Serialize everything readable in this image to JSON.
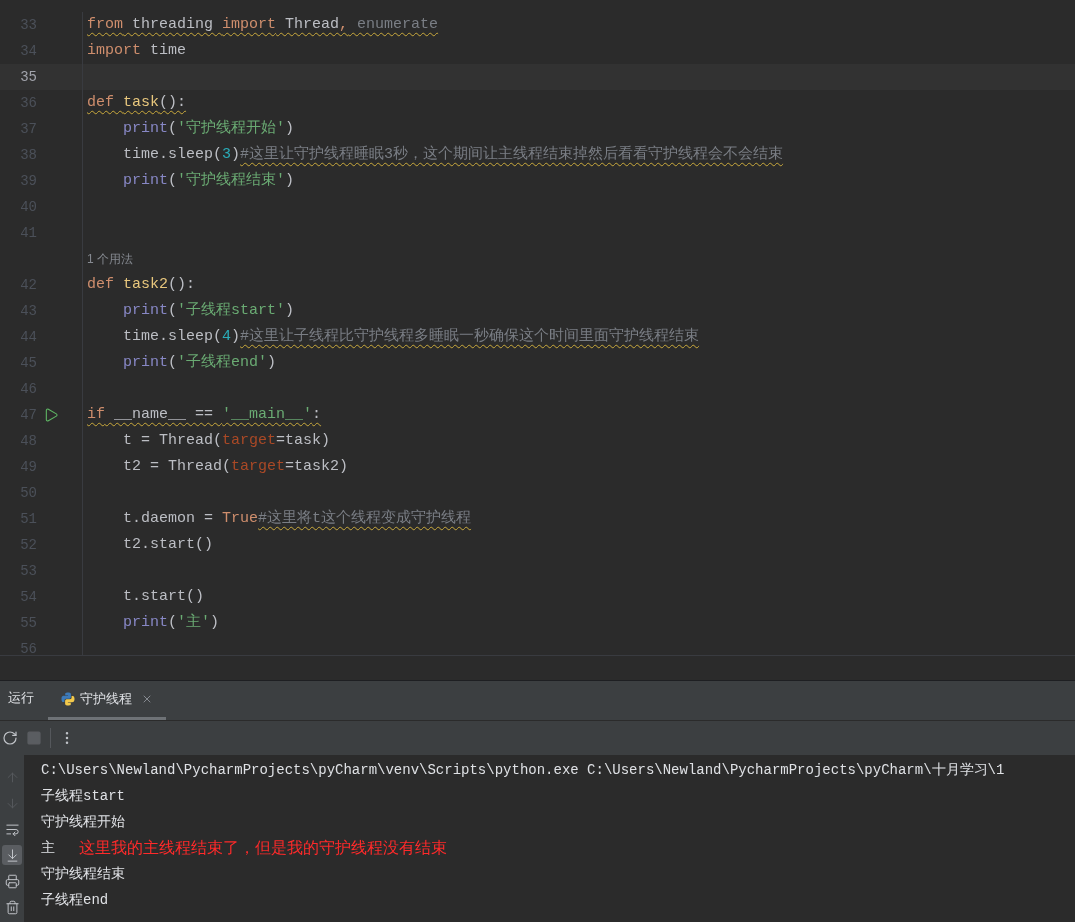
{
  "editor": {
    "lines": [
      {
        "number": "33",
        "current": false,
        "runnable": false,
        "tokens": [
          {
            "text": "from",
            "kind": "keyword",
            "warn": true
          },
          {
            "text": " threading ",
            "kind": "plain",
            "warn": true
          },
          {
            "text": "import",
            "kind": "keyword",
            "warn": true
          },
          {
            "text": " Thread",
            "kind": "plain",
            "warn": true
          },
          {
            "text": ",",
            "kind": "keyword",
            "warn": true
          },
          {
            "text": " enumerate",
            "kind": "unused",
            "warn": true
          }
        ]
      },
      {
        "number": "34",
        "current": false,
        "runnable": false,
        "tokens": [
          {
            "text": "import",
            "kind": "keyword",
            "warn": false
          },
          {
            "text": " time",
            "kind": "plain",
            "warn": false
          }
        ]
      },
      {
        "number": "35",
        "current": true,
        "runnable": false
      },
      {
        "number": "36",
        "current": false,
        "runnable": false,
        "tokens": [
          {
            "text": "def ",
            "kind": "keyword",
            "warn": true
          },
          {
            "text": "task",
            "kind": "function",
            "warn": true
          },
          {
            "text": "():",
            "kind": "plain",
            "warn": true
          }
        ]
      },
      {
        "number": "37",
        "current": false,
        "runnable": false,
        "tokens": [
          {
            "text": "    print",
            "kind": "builtin",
            "warn": false
          },
          {
            "text": "(",
            "kind": "plain",
            "warn": false
          },
          {
            "text": "'守护线程开始'",
            "kind": "string",
            "warn": false
          },
          {
            "text": ")",
            "kind": "plain",
            "warn": false
          }
        ]
      },
      {
        "number": "38",
        "current": false,
        "runnable": false,
        "tokens": [
          {
            "text": "    time.sleep(",
            "kind": "plain",
            "warn": false
          },
          {
            "text": "3",
            "kind": "number",
            "warn": false
          },
          {
            "text": ")",
            "kind": "plain",
            "warn": false
          },
          {
            "text": "#这里让守护线程睡眠3秒，这个期间让主线程结束掉然后看看守护线程会不会结束",
            "kind": "comment",
            "warn": true
          }
        ]
      },
      {
        "number": "39",
        "current": false,
        "runnable": false,
        "tokens": [
          {
            "text": "    print",
            "kind": "builtin",
            "warn": false
          },
          {
            "text": "(",
            "kind": "plain",
            "warn": false
          },
          {
            "text": "'守护线程结束'",
            "kind": "string",
            "warn": false
          },
          {
            "text": ")",
            "kind": "plain",
            "warn": false
          }
        ]
      },
      {
        "number": "40",
        "current": false,
        "runnable": false
      },
      {
        "number": "41",
        "current": false,
        "runnable": false
      },
      {
        "number": "42",
        "current": false,
        "runnable": false,
        "usage_hint": "1 个用法",
        "tokens": [
          {
            "text": "def ",
            "kind": "keyword",
            "warn": false
          },
          {
            "text": "task2",
            "kind": "function",
            "warn": false
          },
          {
            "text": "():",
            "kind": "plain",
            "warn": false
          }
        ]
      },
      {
        "number": "43",
        "current": false,
        "runnable": false,
        "tokens": [
          {
            "text": "    print",
            "kind": "builtin",
            "warn": false
          },
          {
            "text": "(",
            "kind": "plain",
            "warn": false
          },
          {
            "text": "'子线程start'",
            "kind": "string",
            "warn": false
          },
          {
            "text": ")",
            "kind": "plain",
            "warn": false
          }
        ]
      },
      {
        "number": "44",
        "current": false,
        "runnable": false,
        "tokens": [
          {
            "text": "    time.sleep(",
            "kind": "plain",
            "warn": false
          },
          {
            "text": "4",
            "kind": "number",
            "warn": false
          },
          {
            "text": ")",
            "kind": "plain",
            "warn": false
          },
          {
            "text": "#这里让子线程比守护线程多睡眠一秒确保这个时间里面守护线程结束",
            "kind": "comment",
            "warn": true
          }
        ]
      },
      {
        "number": "45",
        "current": false,
        "runnable": false,
        "tokens": [
          {
            "text": "    print",
            "kind": "builtin",
            "warn": false
          },
          {
            "text": "(",
            "kind": "plain",
            "warn": false
          },
          {
            "text": "'子线程end'",
            "kind": "string",
            "warn": false
          },
          {
            "text": ")",
            "kind": "plain",
            "warn": false
          }
        ]
      },
      {
        "number": "46",
        "current": false,
        "runnable": false
      },
      {
        "number": "47",
        "current": false,
        "runnable": true,
        "tokens": [
          {
            "text": "if",
            "kind": "keyword",
            "warn": true
          },
          {
            "text": " __name__ == ",
            "kind": "plain",
            "warn": true
          },
          {
            "text": "'__main__'",
            "kind": "string",
            "warn": true
          },
          {
            "text": ":",
            "kind": "plain",
            "warn": true
          }
        ]
      },
      {
        "number": "48",
        "current": false,
        "runnable": false,
        "tokens": [
          {
            "text": "    t = Thread(",
            "kind": "plain",
            "warn": false
          },
          {
            "text": "target",
            "kind": "param",
            "warn": false
          },
          {
            "text": "=task)",
            "kind": "plain",
            "warn": false
          }
        ]
      },
      {
        "number": "49",
        "current": false,
        "runnable": false,
        "tokens": [
          {
            "text": "    t2 = Thread(",
            "kind": "plain",
            "warn": false
          },
          {
            "text": "target",
            "kind": "param",
            "warn": false
          },
          {
            "text": "=task2)",
            "kind": "plain",
            "warn": false
          }
        ]
      },
      {
        "number": "50",
        "current": false,
        "runnable": false
      },
      {
        "number": "51",
        "current": false,
        "runnable": false,
        "tokens": [
          {
            "text": "    t.daemon = ",
            "kind": "plain",
            "warn": false
          },
          {
            "text": "True",
            "kind": "keyword",
            "warn": false
          },
          {
            "text": "#这里将t这个线程变成守护线程",
            "kind": "comment",
            "warn": true
          }
        ]
      },
      {
        "number": "52",
        "current": false,
        "runnable": false,
        "tokens": [
          {
            "text": "    t2.start()",
            "kind": "plain",
            "warn": false
          }
        ]
      },
      {
        "number": "53",
        "current": false,
        "runnable": false
      },
      {
        "number": "54",
        "current": false,
        "runnable": false,
        "tokens": [
          {
            "text": "    t.start()",
            "kind": "plain",
            "warn": false
          }
        ]
      },
      {
        "number": "55",
        "current": false,
        "runnable": false,
        "tokens": [
          {
            "text": "    print",
            "kind": "builtin",
            "warn": false
          },
          {
            "text": "(",
            "kind": "plain",
            "warn": false
          },
          {
            "text": "'主'",
            "kind": "string",
            "warn": false
          },
          {
            "text": ")",
            "kind": "plain",
            "warn": false
          }
        ]
      },
      {
        "number": "56",
        "current": false,
        "runnable": false
      }
    ]
  },
  "run_panel": {
    "title": "运行",
    "tabs": [
      {
        "label": "守护线程",
        "selected": true
      }
    ],
    "toolbar": [
      {
        "kind": "rerun",
        "disabled": false
      },
      {
        "kind": "stop",
        "disabled": true
      },
      {
        "kind": "more",
        "disabled": false
      }
    ],
    "side_tools": [
      {
        "kind": "up",
        "disabled": true,
        "selected": false
      },
      {
        "kind": "down",
        "disabled": true,
        "selected": false
      },
      {
        "kind": "wrap",
        "disabled": false,
        "selected": false
      },
      {
        "kind": "scroll-end",
        "disabled": false,
        "selected": true
      },
      {
        "kind": "print",
        "disabled": false,
        "selected": false
      },
      {
        "kind": "trash",
        "disabled": false,
        "selected": false
      }
    ],
    "console": [
      {
        "text": "C:\\Users\\Newland\\PycharmProjects\\pyCharm\\venv\\Scripts\\python.exe C:\\Users\\Newland\\PycharmProjects\\pyCharm\\十月学习\\1"
      },
      {
        "text": "子线程start"
      },
      {
        "text": "守护线程开始"
      },
      {
        "text": "主",
        "annotation": "这里我的主线程结束了，但是我的守护线程没有结束"
      },
      {
        "text": "守护线程结束"
      },
      {
        "text": "子线程end"
      }
    ]
  }
}
